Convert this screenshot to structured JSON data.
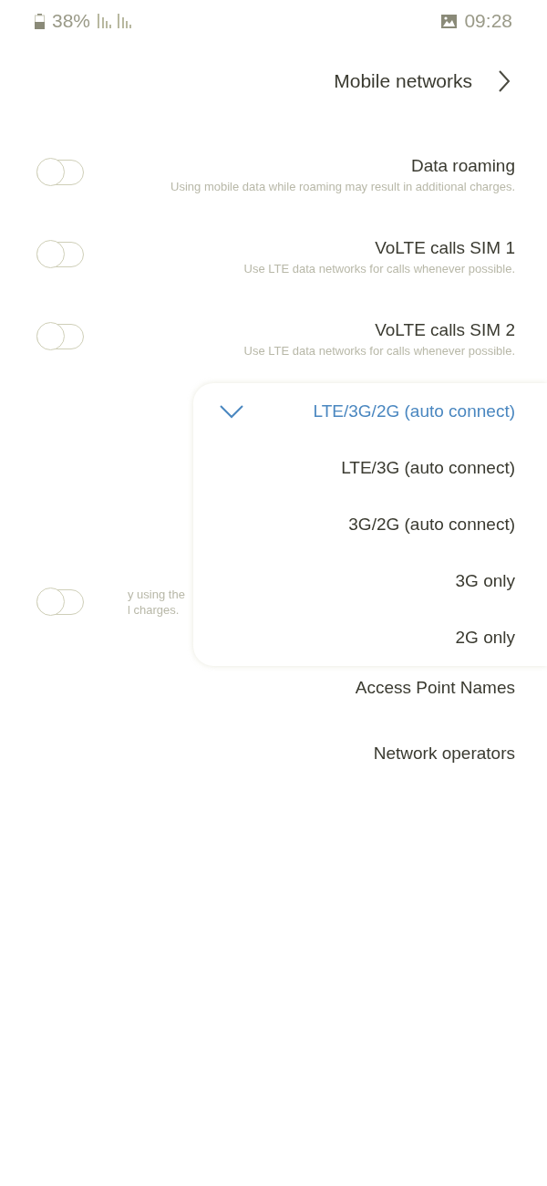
{
  "status_bar": {
    "battery": "38%",
    "time": "09:28"
  },
  "header": {
    "title": "Mobile networks"
  },
  "settings": [
    {
      "kind": "toggle",
      "title": "Data roaming",
      "description": "Using mobile data while roaming may result in additional charges.",
      "on": false
    },
    {
      "kind": "toggle",
      "title": "VoLTE calls SIM 1",
      "description": "Use LTE data networks for calls whenever possible.",
      "on": false
    },
    {
      "kind": "toggle",
      "title": "VoLTE calls SIM 2",
      "description": "Use LTE data networks for calls whenever possible.",
      "on": false
    },
    {
      "kind": "covered",
      "description_lines": [
        "y using the",
        "l charges."
      ],
      "on": false
    },
    {
      "kind": "link",
      "title": "Access Point Names"
    },
    {
      "kind": "link",
      "title": "Network operators"
    }
  ],
  "dropdown": {
    "options": [
      {
        "label": "LTE/3G/2G (auto connect)",
        "selected": true
      },
      {
        "label": "LTE/3G (auto connect)",
        "selected": false
      },
      {
        "label": "3G/2G (auto connect)",
        "selected": false
      },
      {
        "label": "3G only",
        "selected": false
      },
      {
        "label": "2G only",
        "selected": false
      }
    ]
  }
}
